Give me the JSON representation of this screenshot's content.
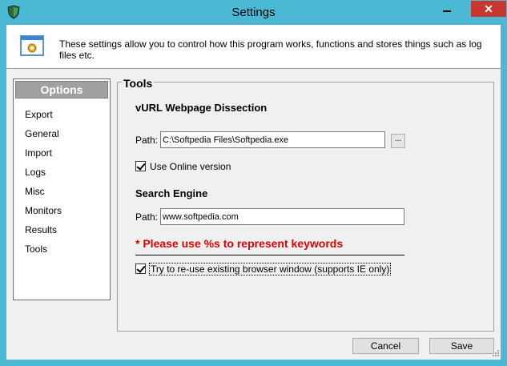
{
  "window": {
    "title": "Settings",
    "close_glyph": "✕"
  },
  "banner": {
    "text": "These settings allow you to control how this program works, functions and stores things such as log files etc.",
    "icon": "settings-window-icon"
  },
  "options": {
    "header": "Options",
    "items": [
      "Export",
      "General",
      "Import",
      "Logs",
      "Misc",
      "Monitors",
      "Results",
      "Tools"
    ],
    "selected": "Tools"
  },
  "tools": {
    "legend": "Tools",
    "vurl": {
      "title": "vURL Webpage Dissection",
      "path_label": "Path:",
      "path_value": "C:\\Softpedia Files\\Softpedia.exe",
      "browse_label": "...",
      "online_label": "Use Online version",
      "online_checked": true
    },
    "search": {
      "title": "Search Engine",
      "path_label": "Path:",
      "path_value": "www.softpedia.com",
      "warning": "* Please use %s to represent keywords",
      "reuse_label": "Try to re-use existing browser window (supports IE only)",
      "reuse_checked": true
    }
  },
  "footer": {
    "cancel_label": "Cancel",
    "save_label": "Save"
  },
  "colors": {
    "titlebar": "#4bb8d4",
    "close_button": "#c7372f",
    "warning": "#e00000"
  }
}
